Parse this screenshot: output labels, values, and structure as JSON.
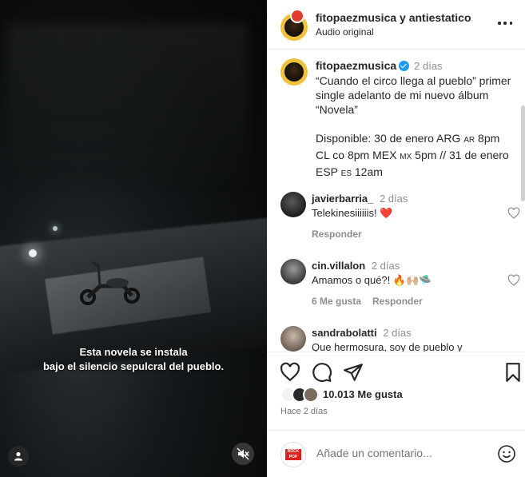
{
  "media": {
    "subtitle_line1": "Esta novela se instala",
    "subtitle_line2": "bajo el silencio sepulcral del pueblo."
  },
  "header": {
    "title": "fitopaezmusica y antiestatico",
    "subtitle": "Audio original"
  },
  "caption": {
    "username": "fitopaezmusica",
    "time": "2 días",
    "text_line1": "“Cuando el circo llega al pueblo” primer single adelanto de mi nuevo álbum “Novela”",
    "text_line2a": "Disponible: 30 de enero ARG ",
    "ar": "AR",
    "text_line2b": " 8pm CL co 8pm MEX ",
    "mx": "MX",
    "text_line2c": " 5pm // 31 de enero ESP ",
    "es": "ES",
    "text_line2d": " 12am"
  },
  "comments": [
    {
      "username": "javierbarria_",
      "time": "2 días",
      "text": "Telekinesiiiiiis! ",
      "emoji": "❤️",
      "reply": "Responder",
      "likes": ""
    },
    {
      "username": "cin.villalon",
      "time": "2 días",
      "text": "Amamos o qué?! ",
      "emoji": "🔥🙌🏼🛸",
      "reply": "Responder",
      "likes": "6 Me gusta"
    },
    {
      "username": "sandrabolatti",
      "time": "2 días",
      "text": "Que hermosura, soy de pueblo y",
      "emoji": "",
      "reply": "",
      "likes": ""
    }
  ],
  "likes_text": "10.013 Me gusta",
  "ago": "Hace 2 días",
  "add_comment_placeholder": "Añade un comentario...",
  "rock_pop_label": "ROCK POP",
  "colors": {
    "verified": "#1d9bf0",
    "heart": "#ed4956",
    "avatar_ring": "#efc23a"
  }
}
